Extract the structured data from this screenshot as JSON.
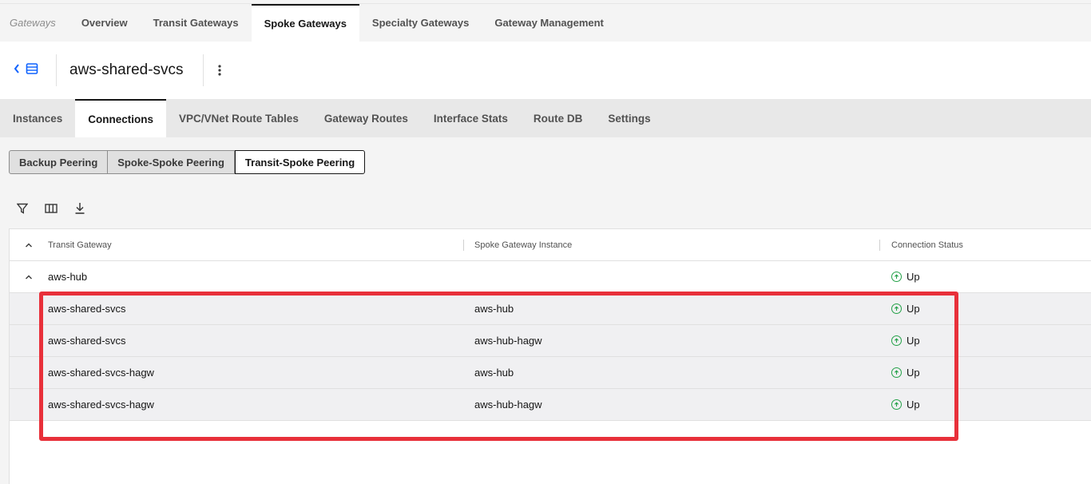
{
  "top_nav": {
    "brand": "Gateways",
    "tabs": [
      {
        "label": "Overview"
      },
      {
        "label": "Transit Gateways"
      },
      {
        "label": "Spoke Gateways"
      },
      {
        "label": "Specialty Gateways"
      },
      {
        "label": "Gateway Management"
      }
    ],
    "active_tab": "Spoke Gateways"
  },
  "header": {
    "title": "aws-shared-svcs"
  },
  "sub_tabs": [
    {
      "label": "Instances"
    },
    {
      "label": "Connections"
    },
    {
      "label": "VPC/VNet Route Tables"
    },
    {
      "label": "Gateway Routes"
    },
    {
      "label": "Interface Stats"
    },
    {
      "label": "Route DB"
    },
    {
      "label": "Settings"
    }
  ],
  "active_sub_tab": "Connections",
  "segments": [
    {
      "label": "Backup Peering"
    },
    {
      "label": "Spoke-Spoke Peering"
    },
    {
      "label": "Transit-Spoke Peering"
    }
  ],
  "active_segment": "Transit-Spoke Peering",
  "toolbar": {
    "icons": [
      "filter-icon",
      "columns-icon",
      "download-icon"
    ]
  },
  "table": {
    "columns": [
      "Transit Gateway",
      "Spoke Gateway Instance",
      "Connection Status"
    ],
    "group": {
      "name": "aws-hub",
      "status": "Up"
    },
    "rows": [
      {
        "transit": "aws-shared-svcs",
        "spoke": "aws-hub",
        "status": "Up"
      },
      {
        "transit": "aws-shared-svcs",
        "spoke": "aws-hub-hagw",
        "status": "Up"
      },
      {
        "transit": "aws-shared-svcs-hagw",
        "spoke": "aws-hub",
        "status": "Up"
      },
      {
        "transit": "aws-shared-svcs-hagw",
        "spoke": "aws-hub-hagw",
        "status": "Up"
      }
    ]
  },
  "colors": {
    "accent": "#0f62fe",
    "status_up": "#24a148",
    "highlight": "#e8303a"
  }
}
